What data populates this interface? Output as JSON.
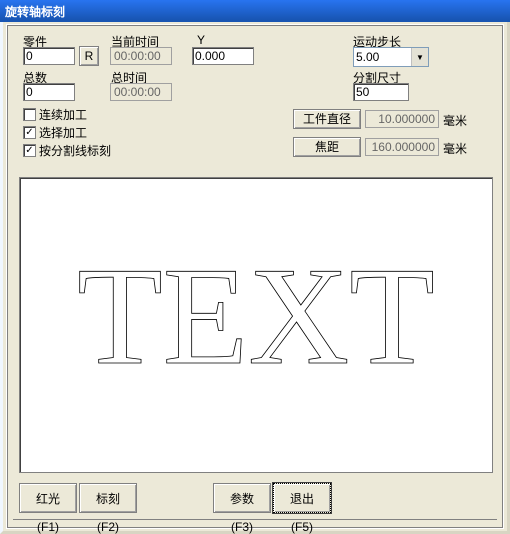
{
  "window": {
    "title": "旋转轴标刻"
  },
  "panel": {
    "part_label": "零件",
    "part_value": "0",
    "r_button": "R",
    "total_label": "总数",
    "total_value": "0",
    "cur_time_label": "当前时间",
    "cur_time_value": "00:00:00",
    "total_time_label": "总时间",
    "total_time_value": "00:00:00",
    "y_label": "Y",
    "y_value": "0.000",
    "step_label": "运动步长",
    "step_value": "5.00",
    "split_label": "分割尺寸",
    "split_value": "50",
    "diam_button": "工件直径",
    "diam_value": "10.000000",
    "diam_unit": "毫米",
    "focal_button": "焦距",
    "focal_value": "160.000000",
    "focal_unit": "毫米"
  },
  "checks": {
    "continuous": "连续加工",
    "select": "选择加工",
    "split_mark": "按分割线标刻"
  },
  "preview_text": "TEXT",
  "buttons": {
    "red": "红光(F1)",
    "mark": "标刻(F2)",
    "param": "参数(F3)",
    "exit": "退出(F5)"
  }
}
